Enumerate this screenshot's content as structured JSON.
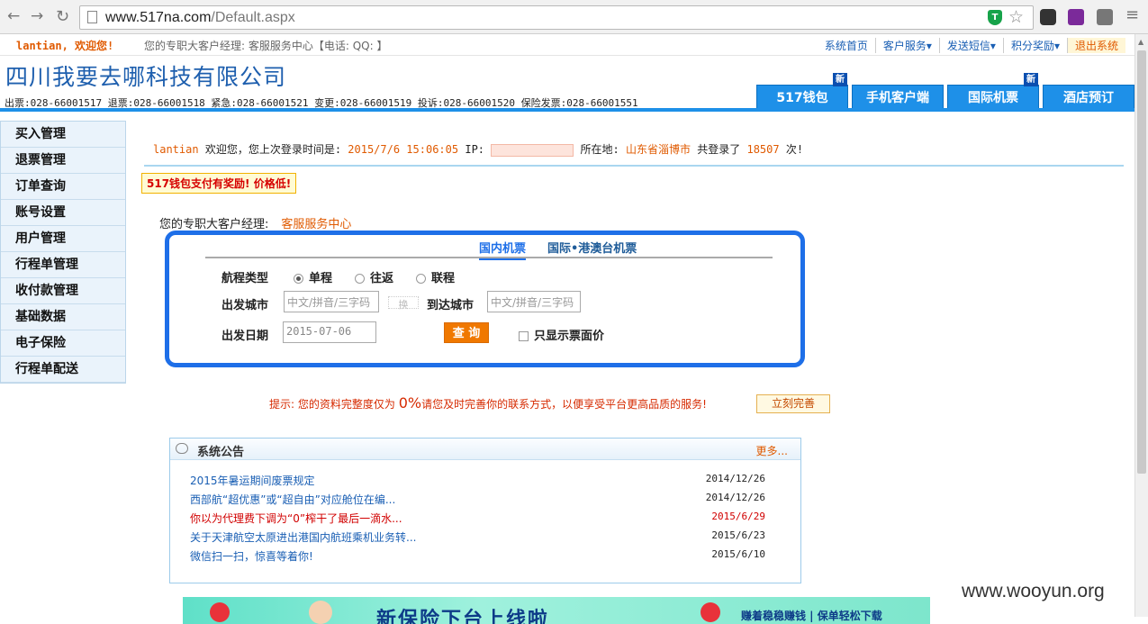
{
  "browser": {
    "url_host": "www.517na.com",
    "url_path": "/Default.aspx"
  },
  "topbar": {
    "welcome": "lantian, 欢迎您!",
    "manager": "您的专职大客户经理: 客服服务中心【电话:   QQ: 】",
    "links": [
      "系统首页",
      "客户服务▾",
      "发送短信▾",
      "积分奖励▾",
      "退出系统"
    ]
  },
  "header": {
    "brand": "四川我要去哪科技有限公司",
    "phones": "出票:028-66001517 退票:028-66001518 紧急:028-66001521  变更:028-66001519 投诉:028-66001520 保险发票:028-66001551",
    "tabs": [
      {
        "label": "517钱包",
        "new": "新"
      },
      {
        "label": "手机客户端",
        "new": ""
      },
      {
        "label": "国际机票",
        "new": "新"
      },
      {
        "label": "酒店预订",
        "new": ""
      }
    ]
  },
  "sidebar": {
    "items": [
      "买入管理",
      "退票管理",
      "订单查询",
      "账号设置",
      "用户管理",
      "行程单管理",
      "收付款管理",
      "基础数据",
      "电子保险",
      "行程单配送"
    ]
  },
  "login": {
    "user": "lantian",
    "text1": "欢迎您，您上次登录时间是:",
    "time": "2015/7/6 15:06:05",
    "ip_label": "IP:",
    "loc_label": "所在地:",
    "location": "山东省淄博市",
    "count_label": "共登录了",
    "count": "18507",
    "count_suffix": "次!"
  },
  "promo": "517钱包支付有奖励! 价格低!",
  "account_manager": {
    "label": "您的专职大客户经理:",
    "value": "客服服务中心"
  },
  "search": {
    "tab_domestic": "国内机票",
    "tab_intl": "国际•港澳台机票",
    "route_type_label": "航程类型",
    "oneway": "单程",
    "roundtrip": "往返",
    "multi": "联程",
    "depart_city_label": "出发城市",
    "depart_placeholder": "中文/拼音/三字码",
    "swap": "换",
    "arrive_city_label": "到达城市",
    "arrive_placeholder": "中文/拼音/三字码",
    "date_label": "出发日期",
    "date_value": "2015-07-06",
    "query_button": "查 询",
    "face_price_only": "只显示票面价"
  },
  "tip": {
    "prefix": "提示: 您的资料完整度仅为 ",
    "percent": "0%",
    "suffix": "请您及时完善你的联系方式，以便享受平台更高品质的服务!",
    "button": "立刻完善"
  },
  "notice": {
    "title": "系统公告",
    "more": "更多...",
    "items": [
      {
        "title": "2015年暑运期间废票规定",
        "date": "2014/12/26"
      },
      {
        "title": "西部航“超优惠”或“超自由”对应舱位在编...",
        "date": "2014/12/26"
      },
      {
        "title": "你以为代理费下调为“0”榨干了最后一滴水...",
        "date": "2015/6/29"
      },
      {
        "title": "关于天津航空太原进出港国内航班乘机业务转...",
        "date": "2015/6/23"
      },
      {
        "title": "微信扫一扫，惊喜等着你!",
        "date": "2015/6/10"
      }
    ]
  },
  "banner": {
    "headline": "新保险下台上线啦",
    "side": "赚着稳稳赚钱 | 保单轻松下载"
  },
  "watermark": "www.wooyun.org"
}
